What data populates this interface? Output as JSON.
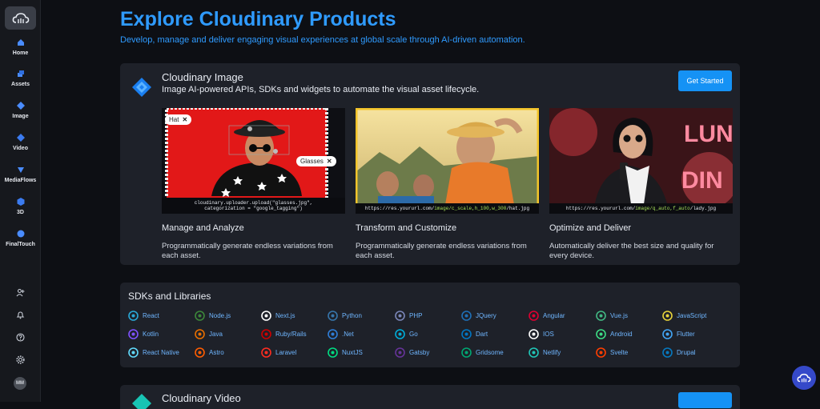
{
  "sidebar": {
    "items": [
      {
        "label": "Home",
        "icon": "home-icon"
      },
      {
        "label": "Assets",
        "icon": "assets-icon"
      },
      {
        "label": "Image",
        "icon": "image-icon"
      },
      {
        "label": "Video",
        "icon": "video-icon"
      },
      {
        "label": "MediaFlows",
        "icon": "mediaflows-icon"
      },
      {
        "label": "3D",
        "icon": "3d-icon"
      },
      {
        "label": "FinalTouch",
        "icon": "finaltouch-icon"
      }
    ],
    "bottom_icons": [
      "add-user-icon",
      "notifications-icon",
      "help-icon",
      "settings-icon"
    ],
    "avatar": "MM"
  },
  "header": {
    "title": "Explore Cloudinary Products",
    "subtitle": "Develop, manage and deliver engaging visual experiences at global scale through AI-driven automation."
  },
  "image_card": {
    "title": "Cloudinary Image",
    "description": "Image AI-powered APIs, SDKs and widgets to automate the visual asset lifecycle.",
    "cta": "Get Started",
    "features": [
      {
        "title": "Manage and Analyze",
        "description": "Programmatically generate endless variations from each asset.",
        "caption_line1": "cloudinary.uploader.upload(\"glasses.jpg\",",
        "caption_line2": "categorization = \"google_tagging\")",
        "tag1": "Hat",
        "tag2": "Glasses"
      },
      {
        "title": "Transform and Customize",
        "description": "Programmatically generate endless variations from each asset.",
        "url_prefix": "https://res.yoururl.com/",
        "url_highlight": "image/c_scale,h_100,w_300",
        "url_suffix": "/hat.jpg"
      },
      {
        "title": "Optimize and Deliver",
        "description": "Automatically deliver the best size and quality for every device.",
        "url_prefix": "https://res.yoururl.com/",
        "url_highlight": "image/q_auto,f_auto",
        "url_suffix": "/lady.jpg"
      }
    ]
  },
  "sdks": {
    "title": "SDKs and Libraries",
    "rows": [
      [
        "React",
        "Node.js",
        "Next.js",
        "Python",
        "PHP",
        "JQuery",
        "Angular",
        "Vue.js",
        "JavaScript"
      ],
      [
        "Kotlin",
        "Java",
        "Ruby/Rails",
        ".Net",
        "Go",
        "Dart",
        "IOS",
        "Android",
        "Flutter"
      ],
      [
        "React Native",
        "Astro",
        "Laravel",
        "NuxtJS",
        "Gatsby",
        "Gridsome",
        "Netlify",
        "Svelte",
        "Drupal"
      ]
    ]
  },
  "video_card": {
    "title": "Cloudinary Video"
  },
  "colors": {
    "accent": "#2f9bff",
    "button": "#1592f5",
    "card_bg": "#1e2129",
    "page_bg": "#0d0f14"
  }
}
